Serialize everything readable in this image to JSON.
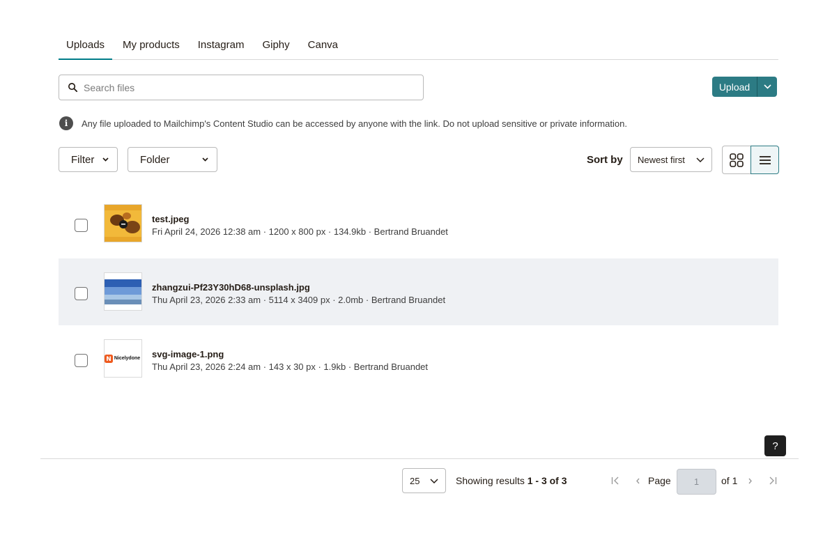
{
  "tabs": [
    {
      "label": "Uploads",
      "active": true
    },
    {
      "label": "My products",
      "active": false
    },
    {
      "label": "Instagram",
      "active": false
    },
    {
      "label": "Giphy",
      "active": false
    },
    {
      "label": "Canva",
      "active": false
    }
  ],
  "search": {
    "placeholder": "Search files",
    "value": ""
  },
  "upload": {
    "label": "Upload"
  },
  "notice": {
    "text": "Any file uploaded to Mailchimp's Content Studio can be accessed by anyone with the link. Do not upload sensitive or private information."
  },
  "filters": {
    "filter_label": "Filter",
    "folder_label": "Folder"
  },
  "sort": {
    "label": "Sort by",
    "value": "Newest first"
  },
  "files": [
    {
      "name": "test.jpeg",
      "meta": "Fri April 24, 2026 12:38 am · 1200 x 800 px · 134.9kb · Bertrand Bruandet",
      "thumb": "photo-yellow"
    },
    {
      "name": "zhangzui-Pf23Y30hD68-unsplash.jpg",
      "meta": "Thu April 23, 2026 2:33 am · 5114 x 3409 px · 2.0mb · Bertrand Bruandet",
      "thumb": "photo-sky"
    },
    {
      "name": "svg-image-1.png",
      "meta": "Thu April 23, 2026 2:24 am · 143 x 30 px · 1.9kb · Bertrand Bruandet",
      "thumb": "logo",
      "thumb_text": "Nicelydone"
    }
  ],
  "help": {
    "label": "?"
  },
  "pagination": {
    "per_page": "25",
    "results_prefix": "Showing results",
    "results_range": "1 - 3 of 3",
    "page_label": "Page",
    "page_value": "1",
    "of_label": "of 1"
  },
  "colors": {
    "accent": "#2c7b84",
    "selected_row": "#eff1f4"
  }
}
